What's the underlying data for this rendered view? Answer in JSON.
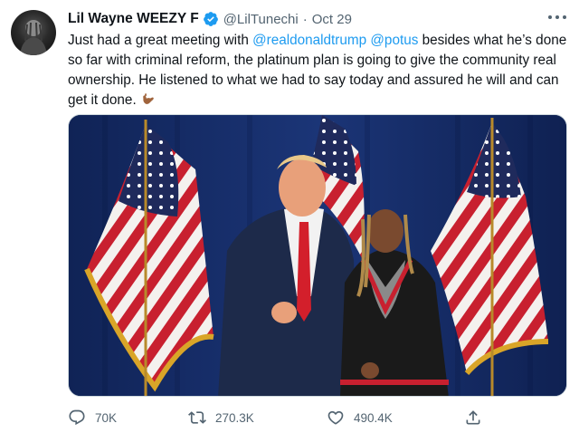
{
  "author": {
    "display_name": "Lil Wayne WEEZY F",
    "handle": "@LilTunechi",
    "separator": "·",
    "date": "Oct 29",
    "verified": true,
    "avatar_icon": "avatar-photo"
  },
  "tweet": {
    "text_1": "Just had a great meeting with ",
    "mention_1": "@realdonaldtrump",
    "text_2": " ",
    "mention_2": "@potus",
    "text_3": " besides what he’s done so far with criminal reform, the platinum plan is going to give the community real ownership. He listened to what we had to say today and assured he will and can get it done.",
    "emoji": "call-me-hand-emoji"
  },
  "media": {
    "description_icon": "photo"
  },
  "actions": {
    "reply_count": "70K",
    "retweet_count": "270.3K",
    "like_count": "490.4K"
  },
  "colors": {
    "accent": "#1d9bf0",
    "secondary_text": "#536471",
    "primary_text": "#0f1419"
  }
}
